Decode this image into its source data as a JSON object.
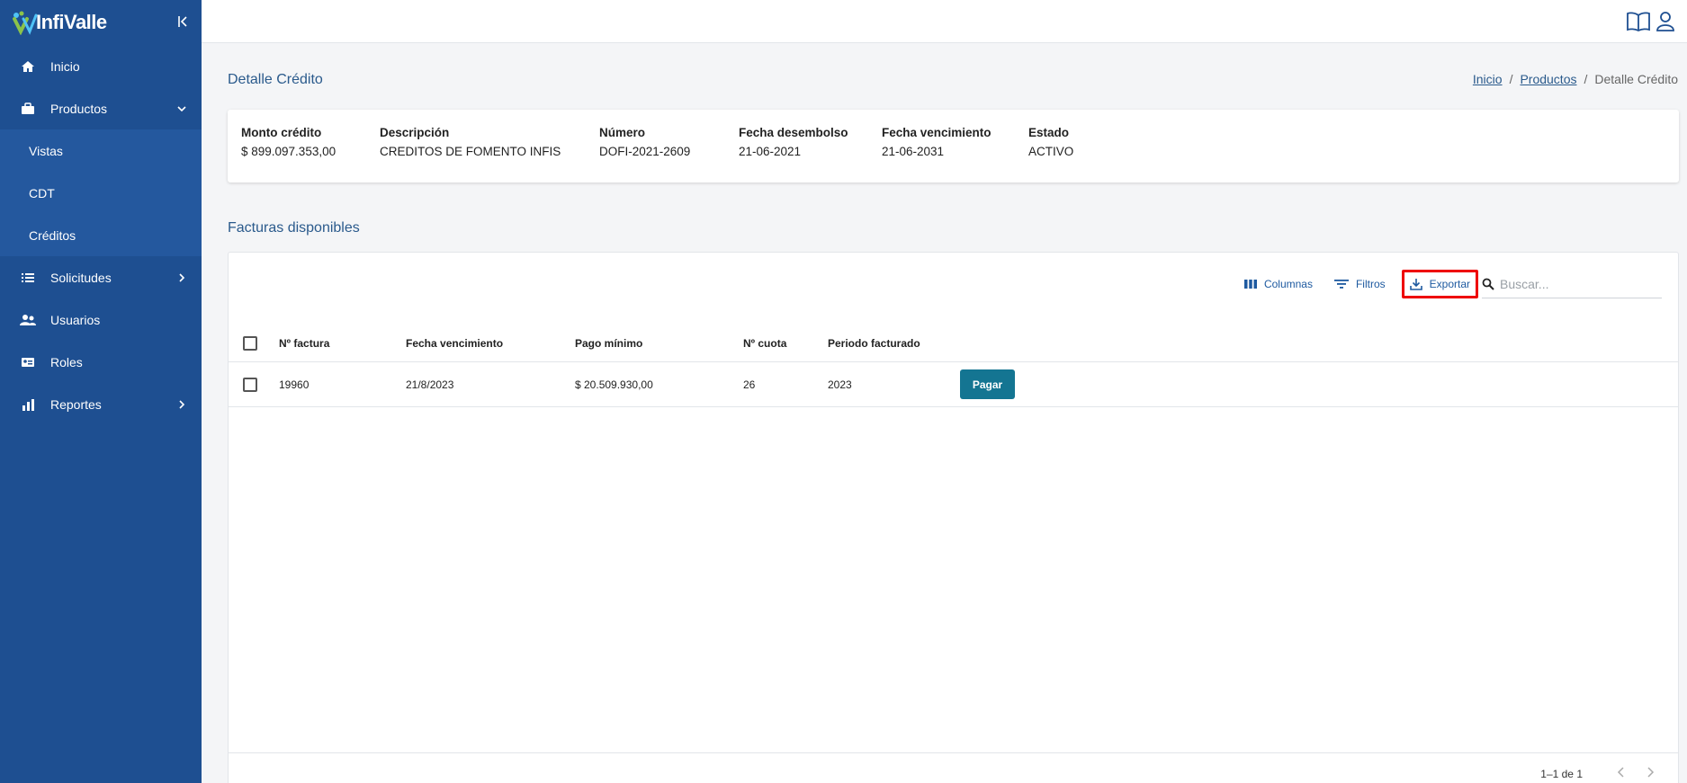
{
  "app": {
    "logo_text": "InfiValle"
  },
  "sidebar": {
    "items": [
      {
        "label": "Inicio",
        "icon": "home-icon"
      },
      {
        "label": "Productos",
        "icon": "briefcase-icon",
        "expanded": true,
        "children": [
          {
            "label": "Vistas"
          },
          {
            "label": "CDT"
          },
          {
            "label": "Créditos"
          }
        ]
      },
      {
        "label": "Solicitudes",
        "icon": "list-icon"
      },
      {
        "label": "Usuarios",
        "icon": "users-icon"
      },
      {
        "label": "Roles",
        "icon": "id-card-icon"
      },
      {
        "label": "Reportes",
        "icon": "bar-chart-icon"
      }
    ]
  },
  "topbar": {
    "icons": [
      "book-icon",
      "user-icon"
    ]
  },
  "page": {
    "title": "Detalle Crédito",
    "breadcrumb": [
      "Inicio",
      "Productos",
      "Detalle Crédito"
    ],
    "breadcrumb_sep": "/"
  },
  "summary": [
    {
      "label": "Monto crédito",
      "value": "$ 899.097.353,00"
    },
    {
      "label": "Descripción",
      "value": "CREDITOS DE FOMENTO INFIS"
    },
    {
      "label": "Número",
      "value": "DOFI-2021-2609"
    },
    {
      "label": "Fecha desembolso",
      "value": "21-06-2021"
    },
    {
      "label": "Fecha vencimiento",
      "value": "21-06-2031"
    },
    {
      "label": "Estado",
      "value": "ACTIVO"
    }
  ],
  "invoices": {
    "title": "Facturas disponibles",
    "toolbar": {
      "columns": "Columnas",
      "filters": "Filtros",
      "export": "Exportar",
      "search_placeholder": "Buscar..."
    },
    "columns": [
      "Nº factura",
      "Fecha vencimiento",
      "Pago mínimo",
      "Nº cuota",
      "Periodo facturado"
    ],
    "rows": [
      {
        "invoice": "19960",
        "due_date": "21/8/2023",
        "min_payment": "$ 20.509.930,00",
        "installment": "26",
        "period": "2023",
        "action": "Pagar"
      }
    ],
    "pagination": "1–1 de 1"
  },
  "colors": {
    "sidebar": "#1e4f91",
    "accent": "#147592",
    "link": "#2a5a8c",
    "highlight": "#e00000"
  }
}
